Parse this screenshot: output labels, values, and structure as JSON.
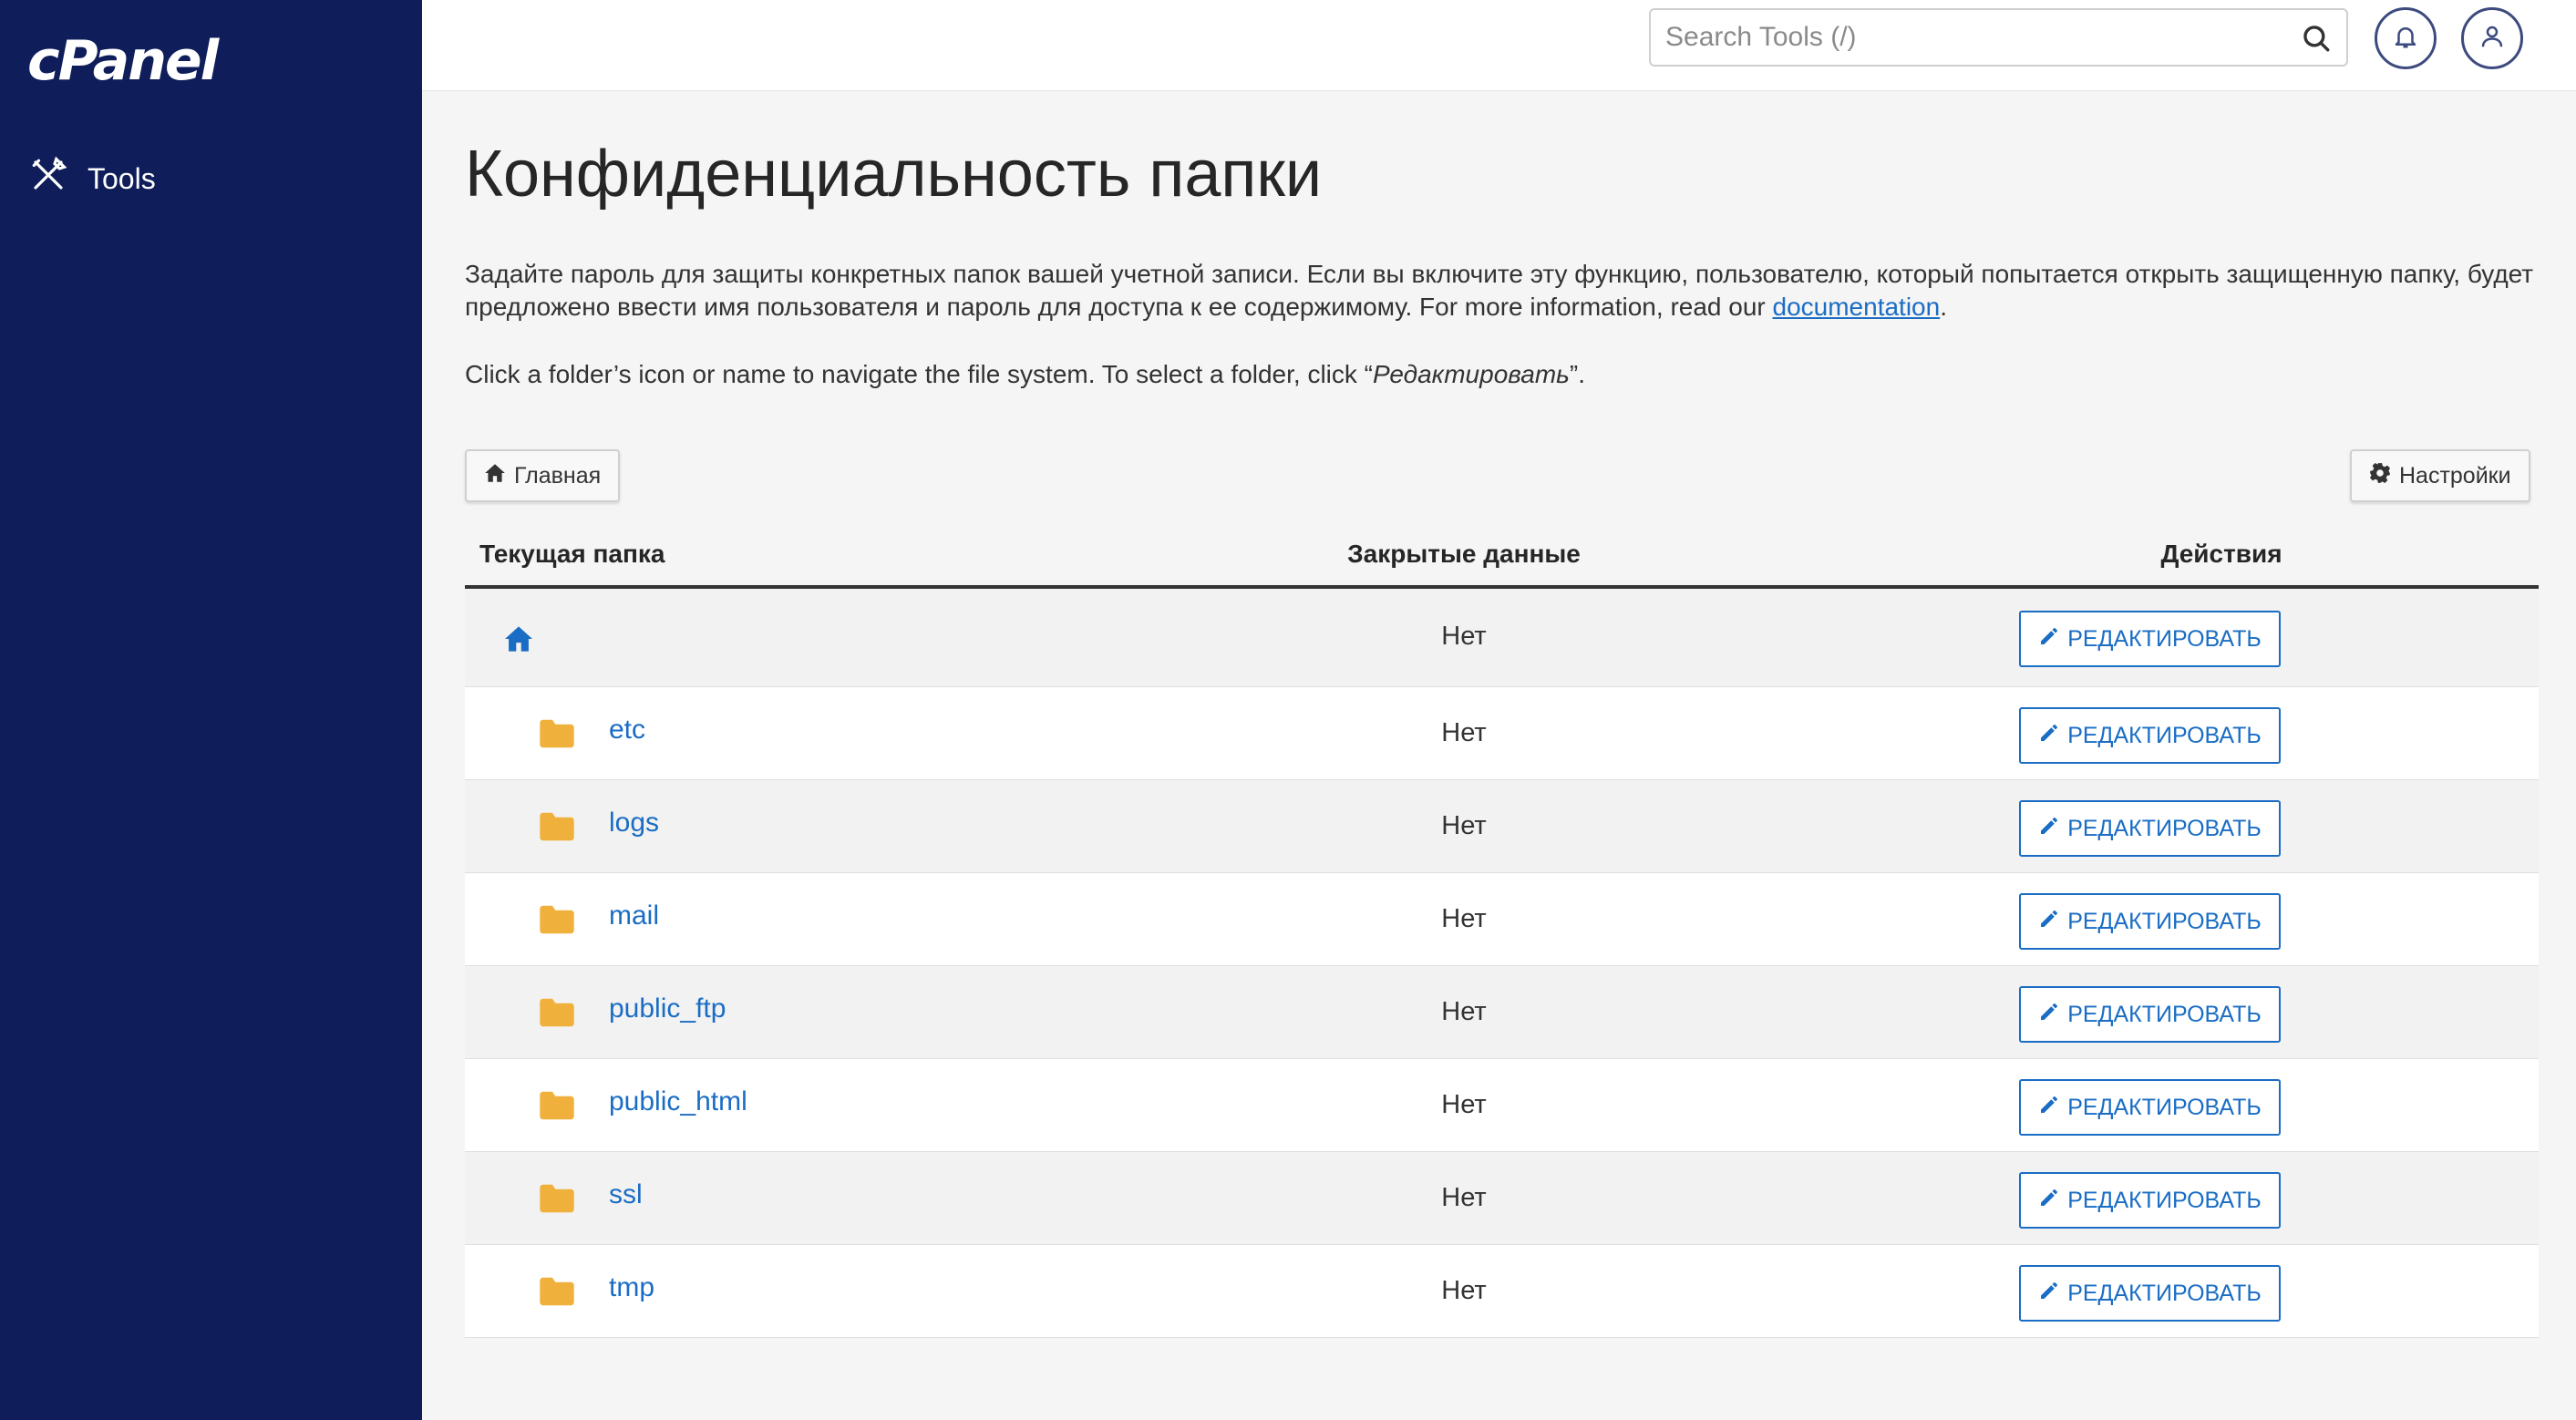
{
  "brand": {
    "logo_text": "cPanel"
  },
  "sidebar": {
    "items": [
      {
        "label": "Tools",
        "icon": "tools-icon"
      }
    ]
  },
  "header": {
    "search_placeholder": "Search Tools (/)",
    "icons": [
      "search-icon",
      "bell-icon",
      "user-icon"
    ]
  },
  "page": {
    "title": "Конфиденциальность папки",
    "description_text": "Задайте пароль для защиты конкретных папок вашей учетной записи. Если вы включите эту функцию, пользователю, который попытается открыть защищенную папку, будет предложено ввести имя пользователя и пароль для доступа к ее содержимому. For more information, read our ",
    "description_link": "documentation",
    "description_end": ".",
    "hint_prefix": "Click a folder’s icon or name to navigate the file system. To select a folder, click “",
    "hint_emphasis": "Редактировать",
    "hint_suffix": "”."
  },
  "toolbar": {
    "home_label": "Главная",
    "settings_label": "Настройки"
  },
  "table": {
    "headers": {
      "folder": "Текущая папка",
      "private": "Закрытые данные",
      "actions": "Действия"
    },
    "edit_label": "РЕДАКТИРОВАТЬ",
    "home_row": {
      "private": "Нет"
    },
    "rows": [
      {
        "name": "etc",
        "private": "Нет"
      },
      {
        "name": "logs",
        "private": "Нет"
      },
      {
        "name": "mail",
        "private": "Нет"
      },
      {
        "name": "public_ftp",
        "private": "Нет"
      },
      {
        "name": "public_html",
        "private": "Нет"
      },
      {
        "name": "ssl",
        "private": "Нет"
      },
      {
        "name": "tmp",
        "private": "Нет"
      }
    ]
  },
  "colors": {
    "sidebar_bg": "#0f1e5a",
    "link": "#1a6dc4",
    "folder": "#f0b03c"
  }
}
